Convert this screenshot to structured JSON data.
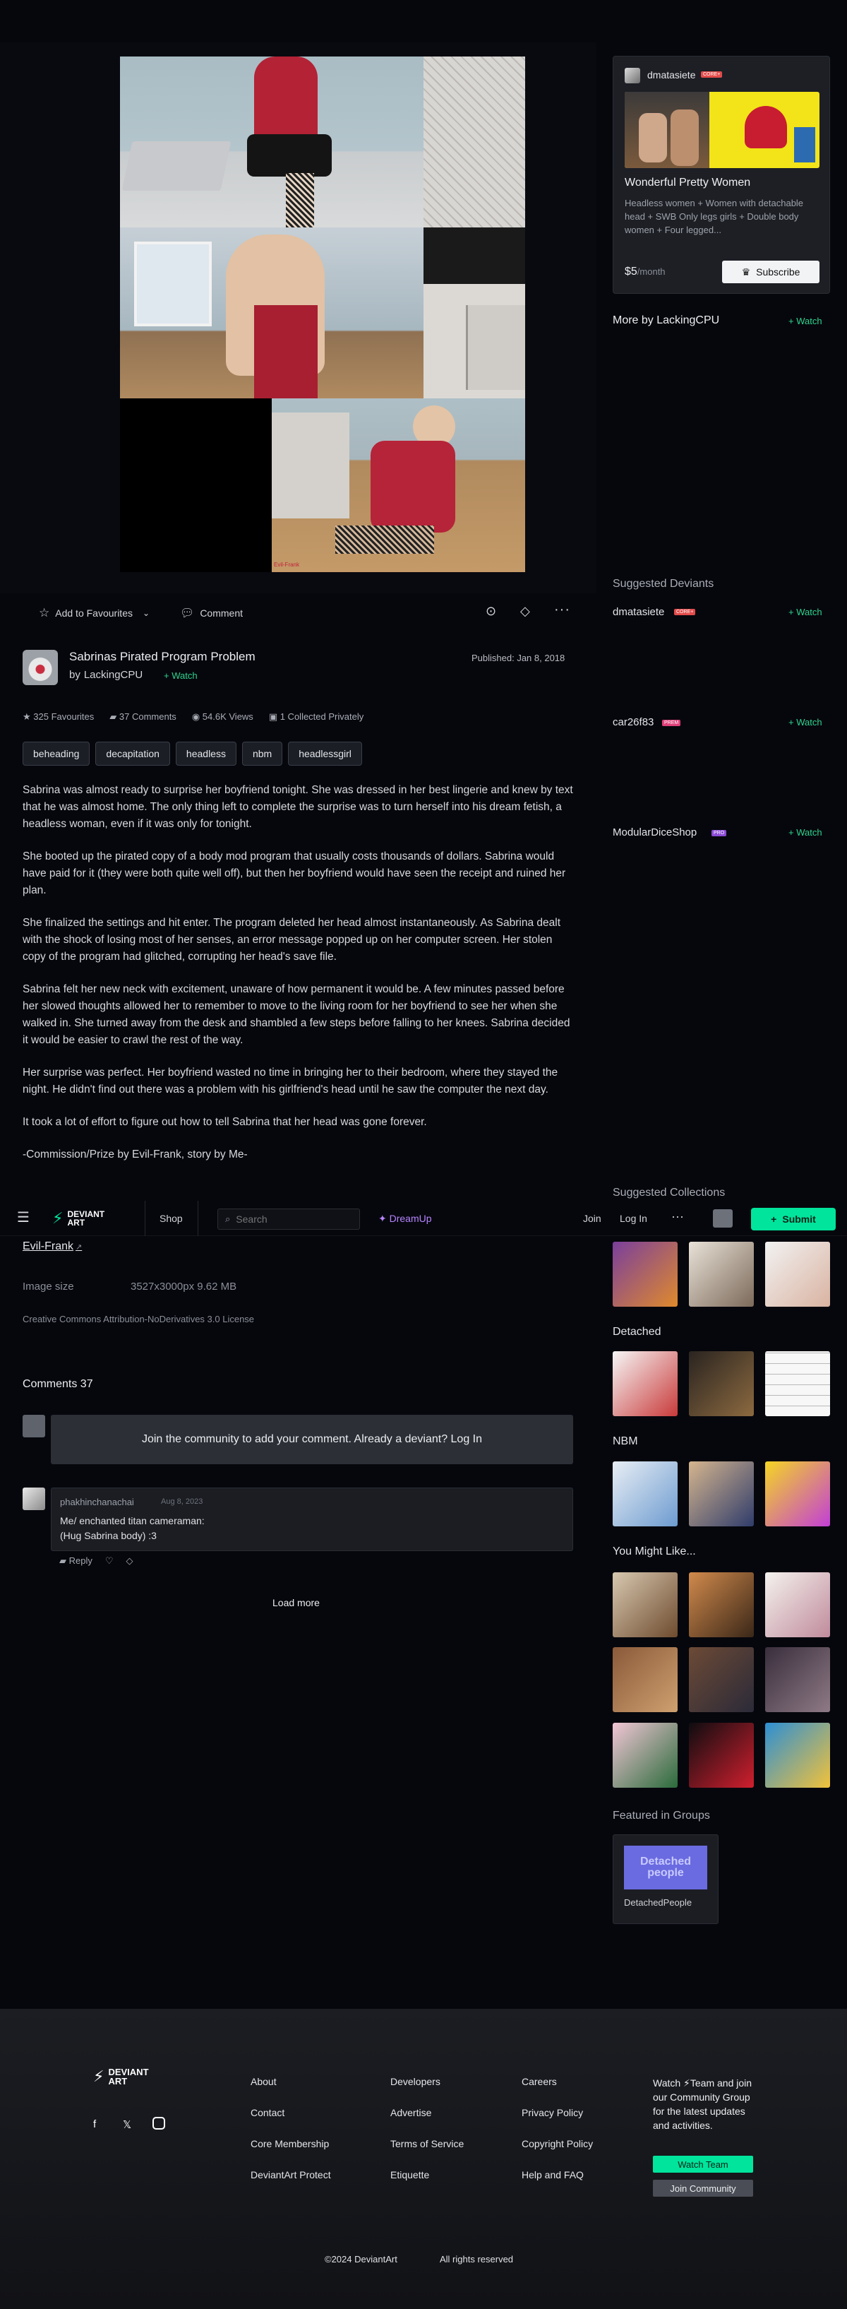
{
  "header": {
    "logo_text_1": "DEVIANT",
    "logo_text_2": "ART",
    "shop": "Shop",
    "search_placeholder": "Search",
    "dreamup": "DreamUp",
    "join": "Join",
    "login": "Log In",
    "submit": "Submit"
  },
  "art": {
    "signature": "Evil-Frank"
  },
  "actions": {
    "favourite": "Add to Favourites",
    "comment": "Comment"
  },
  "deviation": {
    "title": "Sabrinas Pirated Program Problem",
    "by_prefix": "by",
    "author": "LackingCPU",
    "watch": "Watch",
    "published": "Published: Jan 8, 2018",
    "stats": {
      "favourites": "325 Favourites",
      "comments": "37 Comments",
      "views": "54.6K Views",
      "collected": "1 Collected Privately"
    },
    "tags": [
      "beheading",
      "decapitation",
      "headless",
      "nbm",
      "headlessgirl"
    ],
    "description": [
      "Sabrina was almost ready to surprise her boyfriend tonight. She was dressed in her best lingerie and knew by text that he was almost home. The only thing left to complete the surprise was to turn herself into his dream fetish, a headless woman, even if it was only for tonight.",
      "She booted up the pirated copy of a body mod program that usually costs thousands of dollars. Sabrina would have paid for it (they were both quite well off), but then her boyfriend would have seen the receipt and ruined her plan.",
      "She finalized the settings and hit enter. The program deleted her head almost instantaneously. As Sabrina dealt with the shock of losing most of her senses, an error message popped up on her computer screen. Her stolen copy of the program had glitched, corrupting her head's save file.",
      "Sabrina felt her new neck with excitement, unaware of how permanent it would be. A few minutes passed before her slowed thoughts allowed her to remember to move to the living room for her boyfriend to see her when she walked in. She turned away from the desk and shambled a few steps before falling to her knees. Sabrina decided it would be easier to crawl the rest of the way.",
      "Her surprise was perfect. Her boyfriend wasted no time in bringing her to their bedroom, where they stayed the night. He didn't find out there was a problem with his girlfriend's head until he saw the computer the next day.",
      "It took a lot of effort to figure out how to tell Sabrina that her head was gone forever.",
      "-Commission/Prize by Evil-Frank, story by Me-"
    ],
    "link": "Evil-Frank",
    "image_size_label": "Image size",
    "image_size_value": "3527x3000px 9.62 MB",
    "license": "Creative Commons Attribution-NoDerivatives 3.0 License"
  },
  "comments": {
    "heading": "Comments 37",
    "join_prompt": "Join the community to add your comment. Already a deviant? Log In",
    "items": [
      {
        "user": "phakhinchanachai",
        "date": "Aug 8, 2023",
        "line1": "Me/ enchanted titan cameraman:",
        "line2": "(Hug Sabrina body) :3",
        "reply": "Reply"
      }
    ],
    "load_more": "Load more"
  },
  "sidebar": {
    "promo": {
      "user": "dmatasiete",
      "badge": "CORE+",
      "title": "Wonderful Pretty Women",
      "desc": "Headless women + Women with detachable head + SWB Only legs girls + Double body women + Four legged...",
      "price": "$5",
      "period": "/month",
      "subscribe": "Subscribe"
    },
    "more_by": "More by LackingCPU",
    "watch": "Watch",
    "suggested_deviants": "Suggested Deviants",
    "deviants": [
      {
        "name": "dmatasiete",
        "badge": "CORE+"
      },
      {
        "name": "car26f83",
        "badge": "PREM"
      },
      {
        "name": "ModularDiceShop",
        "badge": "PRO"
      }
    ],
    "suggested_collections": "Suggested Collections",
    "collections": [
      "Detached",
      "NBM",
      "You Might Like..."
    ],
    "featured_in_groups": "Featured in Groups",
    "group_name": "DetachedPeople",
    "group_banner": "Detached people"
  },
  "footer": {
    "logo_text_1": "DEVIANT",
    "logo_text_2": "ART",
    "col1": [
      "About",
      "Contact",
      "Core Membership",
      "DeviantArt Protect"
    ],
    "col2": [
      "Developers",
      "Advertise",
      "Terms of Service",
      "Etiquette"
    ],
    "col3": [
      "Careers",
      "Privacy Policy",
      "Copyright Policy",
      "Help and FAQ"
    ],
    "watch_team_text": "Watch ⚡Team and join our Community Group for the latest updates and activities.",
    "watch_team": "Watch Team",
    "join_community": "Join Community",
    "copyright": "©2024 DeviantArt",
    "rights": "All rights reserved"
  },
  "colors": {
    "accent": "#2fd38d",
    "submit_bg": "#00e59b",
    "background": "#06070d"
  }
}
